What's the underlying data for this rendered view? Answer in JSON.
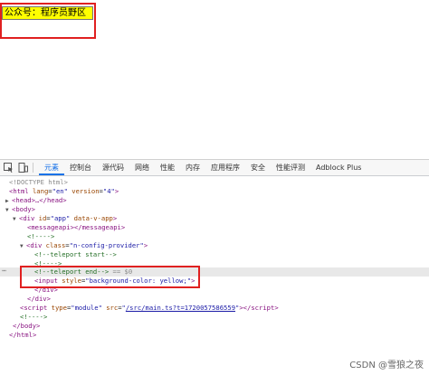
{
  "page": {
    "input_value": "公众号：程序员野区"
  },
  "devtools": {
    "tabs": [
      "元素",
      "控制台",
      "源代码",
      "网络",
      "性能",
      "内存",
      "应用程序",
      "安全",
      "性能评测",
      "Adblock Plus"
    ],
    "active_tab": "元素",
    "tree": {
      "doctype": "<!DOCTYPE html>",
      "html_open": {
        "tag": "html",
        "attrs": [
          [
            "lang",
            "en"
          ],
          [
            "version",
            "4"
          ]
        ]
      },
      "head": "<head>…</head>",
      "body_open": "<body>",
      "div_app": {
        "tag": "div",
        "attrs": [
          [
            "id",
            "app"
          ]
        ],
        "extra": "data-v-app"
      },
      "messageapi": "<messageapi></messageapi>",
      "comment1": "<!---->",
      "div_config": {
        "tag": "div",
        "attrs": [
          [
            "class",
            "n-config-provider"
          ]
        ]
      },
      "teleport_start": "<!--teleport start-->",
      "teleport_end": "<!--teleport end-->",
      "teleport_end_suffix": "== $0",
      "input_el": {
        "tag": "input",
        "attrs": [
          [
            "style",
            "background-color: yellow;"
          ]
        ]
      },
      "div_close1": "</div>",
      "div_close2": "</div>",
      "script_el": {
        "tag": "script",
        "attrs": [
          [
            "type",
            "module"
          ]
        ],
        "src_label": "src",
        "src": "/src/main.ts?t=1720057586559"
      },
      "comment2": "<!---->",
      "body_close": "</body>",
      "html_close": "</html>"
    }
  },
  "watermark": "CSDN @雪狼之夜",
  "colors": {
    "highlight_box": "#e02020",
    "input_bg": "#ffff00",
    "active_tab": "#1a73e8"
  }
}
